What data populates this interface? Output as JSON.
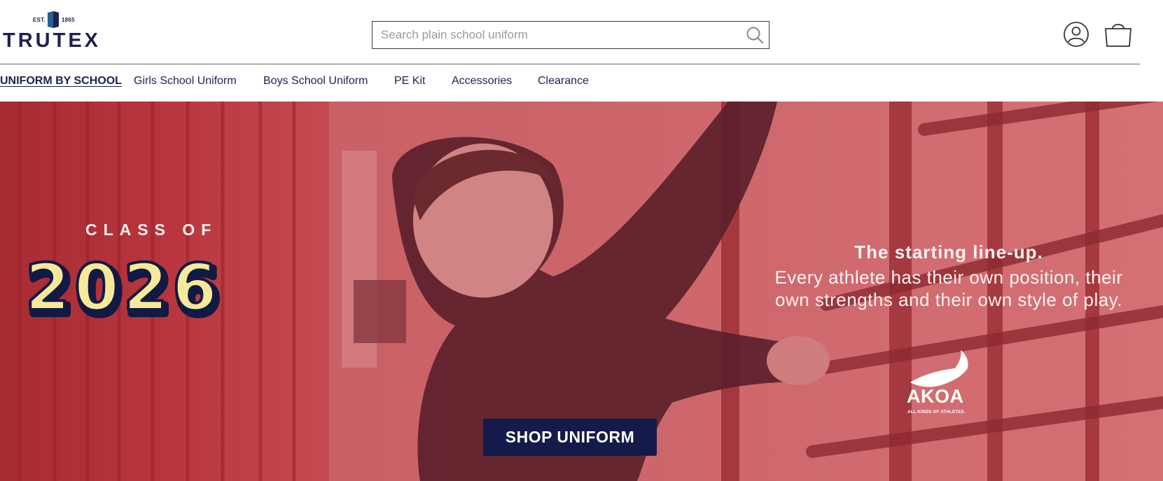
{
  "brand": {
    "name": "TRUTEX",
    "est_label": "EST.",
    "est_year": "1865",
    "colors": {
      "navy": "#1b2250",
      "cta_bg": "#141a4a",
      "hero_red": "#b8434b",
      "year_fill": "#f6ea9a"
    }
  },
  "search": {
    "placeholder": "Search plain school uniform",
    "value": "",
    "icon": "search-icon"
  },
  "header_icons": {
    "account": "account-icon",
    "basket": "basket-icon"
  },
  "nav": {
    "items": [
      {
        "label": "UNIFORM BY SCHOOL",
        "active": true
      },
      {
        "label": "Girls School Uniform",
        "active": false
      },
      {
        "label": "Boys School Uniform",
        "active": false
      },
      {
        "label": "PE Kit",
        "active": false
      },
      {
        "label": "Accessories",
        "active": false
      },
      {
        "label": "Clearance",
        "active": false
      }
    ]
  },
  "hero": {
    "class_of": "CLASS OF",
    "year": "2026",
    "tagline_heading": "The starting line-up.",
    "tagline_line1": "Every athlete has their own position, their",
    "tagline_line2": "own strengths and their own style of play.",
    "partner_logo": "AKOA",
    "partner_tagline": "ALL KINDS OF ATHLETES.",
    "cta_label": "SHOP UNIFORM"
  }
}
